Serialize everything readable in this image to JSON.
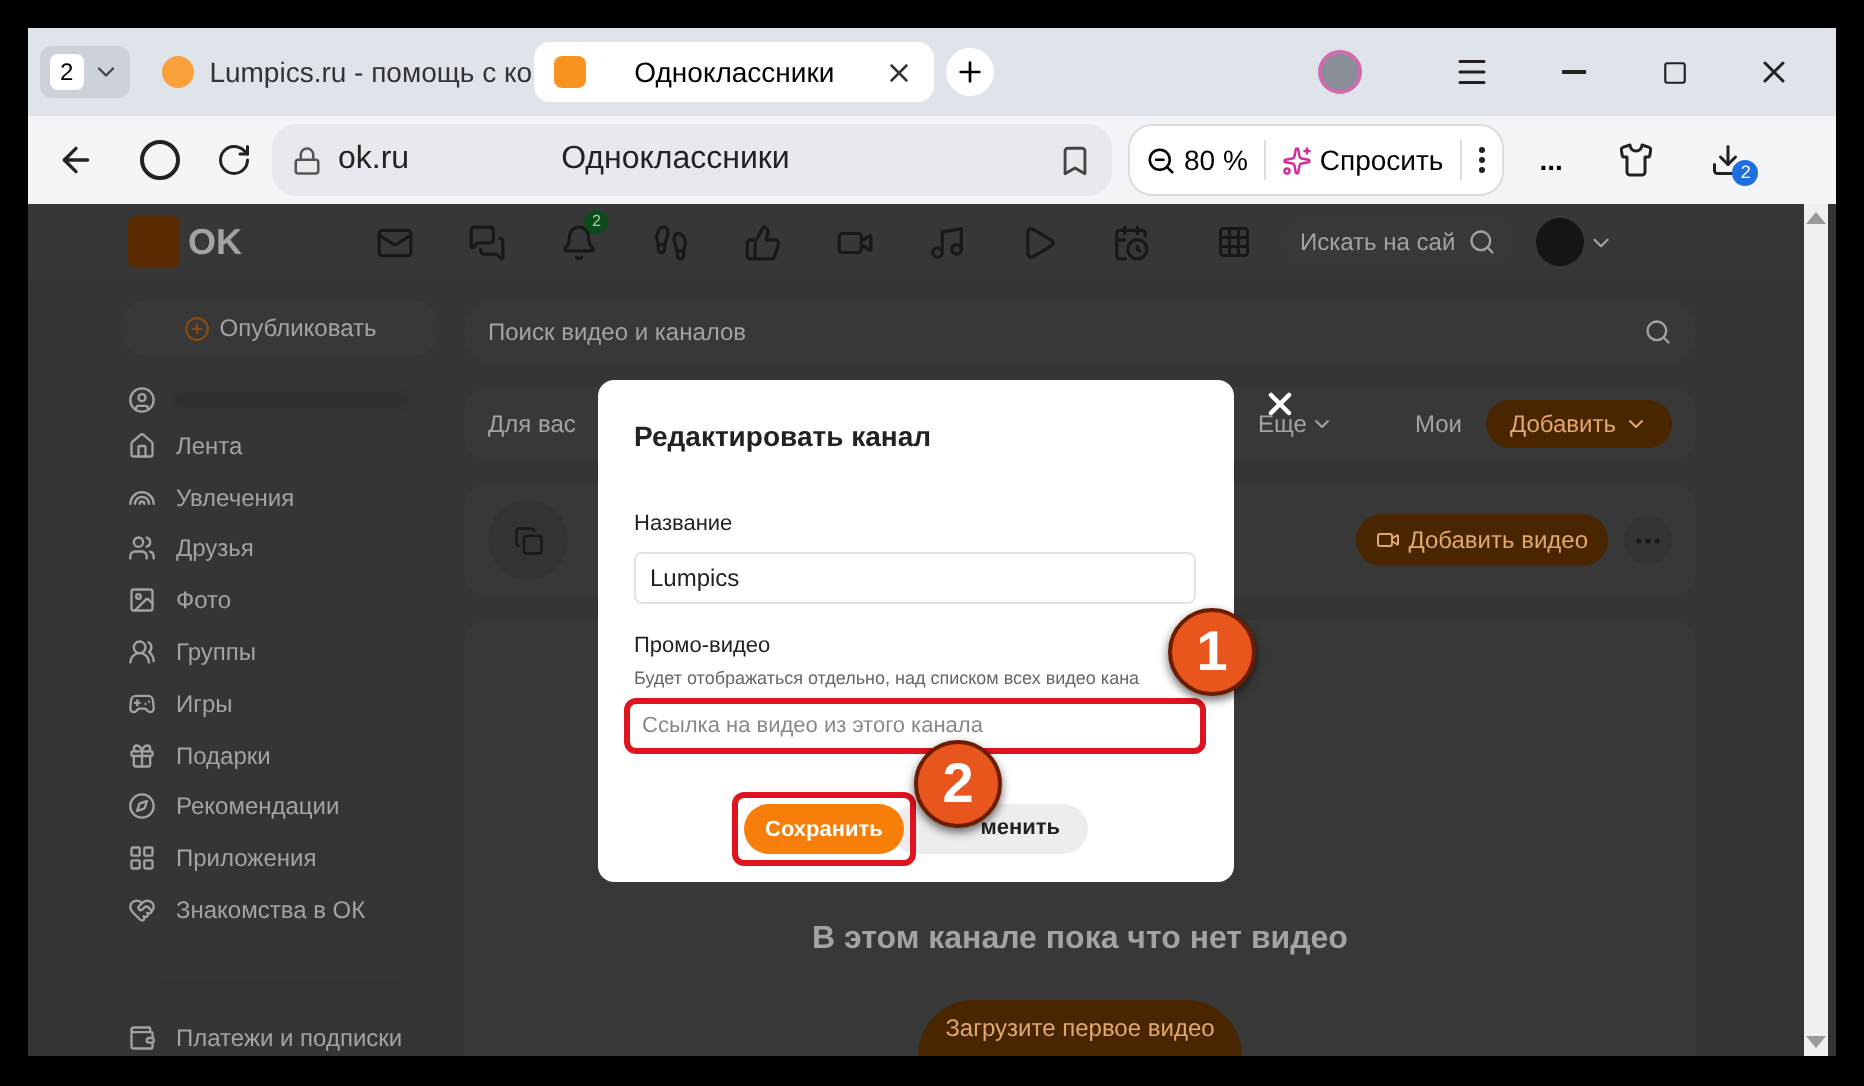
{
  "browser": {
    "tab_count": "2",
    "tabs": [
      {
        "title": "Lumpics.ru - помощь с ко",
        "selected": false
      },
      {
        "title": "Одноклассники",
        "selected": true
      }
    ],
    "address": "ok.ru",
    "page_title": "Одноклассники",
    "zoom": "80 %",
    "ask_button": "Спросить",
    "more": "...",
    "downloads_badge": "2"
  },
  "site_header": {
    "logo": "OK",
    "notifications_badge": "2",
    "search_placeholder": "Искать на сай"
  },
  "sidebar": {
    "publish_button": "Опубликовать",
    "items": [
      "Лента",
      "Увлечения",
      "Друзья",
      "Фото",
      "Группы",
      "Игры",
      "Подарки",
      "Рекомендации",
      "Приложения",
      "Знакомства в ОК"
    ],
    "footer_item": "Платежи и подписки"
  },
  "video": {
    "search_placeholder": "Поиск видео и каналов",
    "first_tab": "Для вас",
    "more_tab": "Еще",
    "my_tab": "Мои",
    "add_button": "Добавить",
    "add_video_button": "Добавить видео",
    "empty_message": "В этом канале пока что нет видео",
    "upload_button": "Загрузите первое видео"
  },
  "dialog": {
    "title": "Редактировать канал",
    "name_label": "Название",
    "name_value": "Lumpics",
    "promo_label": "Промо-видео",
    "promo_hint": "Будет отображаться отдельно, над списком всех видео кана",
    "promo_placeholder": "Ссылка на видео из этого канала",
    "save_button": "Сохранить",
    "cancel_button": "менить"
  },
  "annotations": [
    {
      "number": "1"
    },
    {
      "number": "2"
    }
  ]
}
